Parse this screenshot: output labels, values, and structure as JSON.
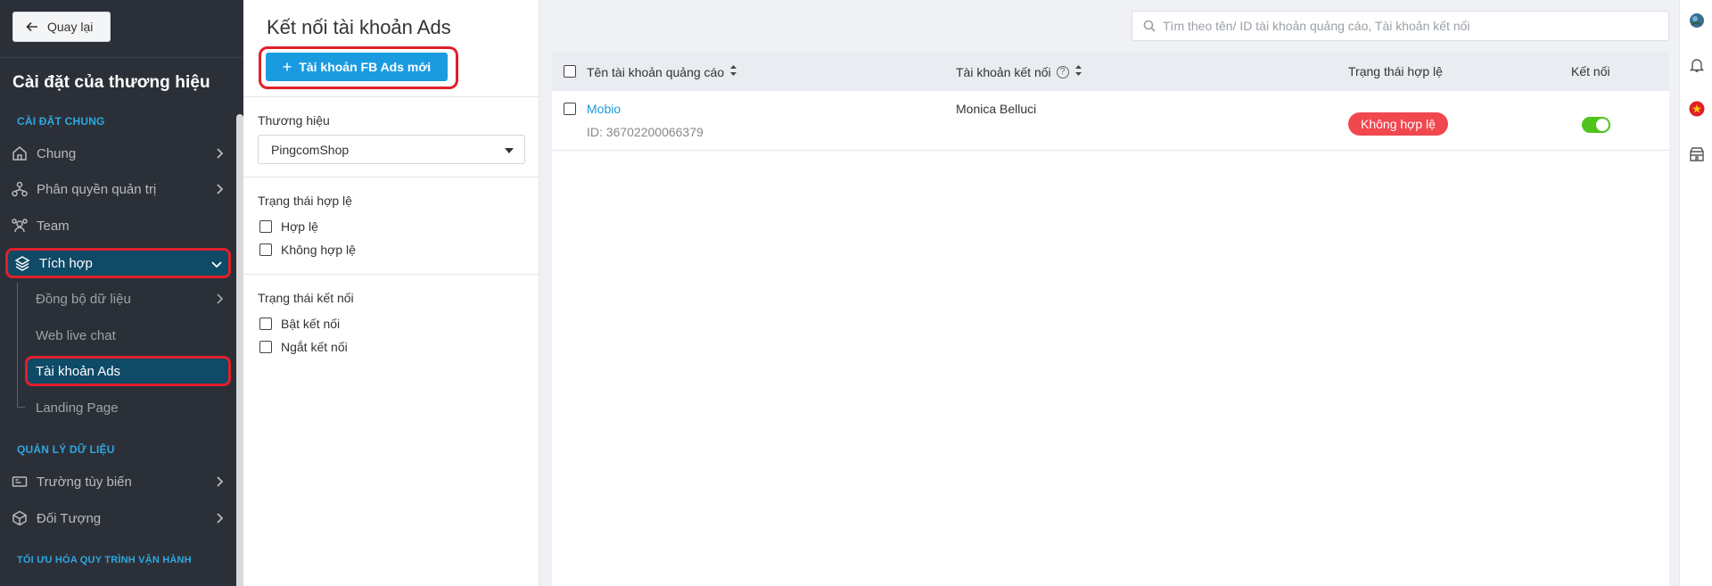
{
  "sidebar": {
    "back_label": "Quay lại",
    "title": "Cài đặt của thương hiệu",
    "sections": {
      "general": "CÀI ĐẶT CHUNG",
      "data": "QUẢN LÝ DỮ LIỆU",
      "optimize": "TỐI ƯU HÓA QUY TRÌNH VẬN HÀNH"
    },
    "items": {
      "chung": "Chung",
      "phan_quyen": "Phân quyền quản trị",
      "team": "Team",
      "tich_hop": "Tích hợp",
      "truong": "Trường tùy biến",
      "doi_tuong": "Đối Tượng"
    },
    "subitems": {
      "dong_bo": "Đồng bộ dữ liệu",
      "web_chat": "Web live chat",
      "ads": "Tài khoản Ads",
      "landing": "Landing Page"
    }
  },
  "filter": {
    "page_title": "Kết nối tài khoản Ads",
    "add_button": "Tài khoản FB Ads mới",
    "brand_label": "Thương hiệu",
    "brand_value": "PingcomShop",
    "valid_status_label": "Trạng thái hợp lệ",
    "valid_options": [
      "Hợp lệ",
      "Không hợp lệ"
    ],
    "connect_status_label": "Trạng thái kết nối",
    "connect_options": [
      "Bật kết nối",
      "Ngắt kết nối"
    ]
  },
  "main": {
    "search_placeholder": "Tìm theo tên/ ID tài khoản quảng cáo, Tài khoản kết nối",
    "columns": {
      "name": "Tên tài khoản quảng cáo",
      "account": "Tài khoản kết nối",
      "status": "Trạng thái hợp lệ",
      "connect": "Kết nối"
    },
    "rows": [
      {
        "name": "Mobio",
        "id": "ID: 36702200066379",
        "account": "Monica Belluci",
        "status": "Không hợp lệ",
        "connected": true
      }
    ]
  },
  "colors": {
    "sidebar_bg": "#2b3038",
    "accent": "#1a9be0",
    "active_bg": "#0f4a66",
    "highlight": "#e0202b",
    "invalid_badge": "#f1474f",
    "toggle_on": "#4fc41c"
  }
}
